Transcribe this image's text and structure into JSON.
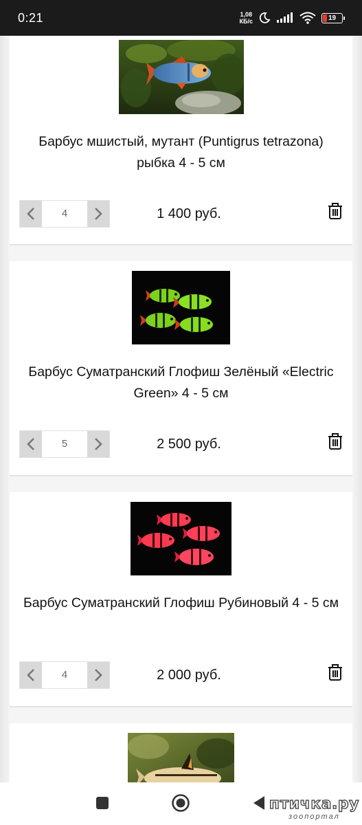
{
  "status_bar": {
    "time": "0:21",
    "net_speed_value": "1,08",
    "net_speed_unit": "КБ/с",
    "battery_level": "19"
  },
  "products": [
    {
      "title": "Барбус мшистый, мутант (Puntigrus tetrazona) рыбка 4 - 5 см",
      "quantity": "4",
      "price": "1 400 руб."
    },
    {
      "title": "Барбус Суматранский Глофиш Зелёный «Electric Green» 4 - 5 см",
      "quantity": "5",
      "price": "2 500 руб."
    },
    {
      "title": "Барбус Суматранский Глофиш Рубиновый 4 - 5 см",
      "quantity": "4",
      "price": "2 000 руб."
    }
  ],
  "icons": {
    "qty_decrease": "chevron-left-icon",
    "qty_increase": "chevron-right-icon",
    "remove": "trash-icon",
    "nav_recents": "square-icon",
    "nav_home": "circle-icon",
    "nav_back": "triangle-back-icon"
  },
  "colors": {
    "status_bar_bg": "#1b1b1b",
    "battery_low": "#e53935",
    "stepper_button": "#d9d9d9"
  },
  "watermark": {
    "main": "птичка.ру",
    "sub": "зоопортал"
  }
}
